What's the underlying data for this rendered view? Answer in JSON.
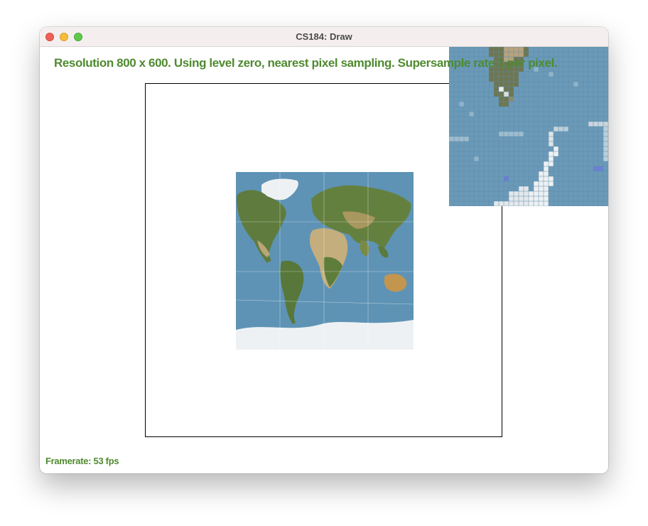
{
  "window": {
    "title": "CS184: Draw"
  },
  "status": {
    "message": "Resolution 800 x 600. Using level zero, nearest pixel sampling. Supersample rate 1 per pixel.",
    "framerate": "Framerate: 53 fps"
  },
  "colors": {
    "status_text": "#4f8a2f",
    "ocean": "#5e93b5",
    "land_green": "#5a7a3a",
    "land_desert": "#c9b68a",
    "ice": "#f2f4f6"
  },
  "icons": {
    "close": "close-icon",
    "minimize": "minimize-icon",
    "maximize": "maximize-icon"
  }
}
